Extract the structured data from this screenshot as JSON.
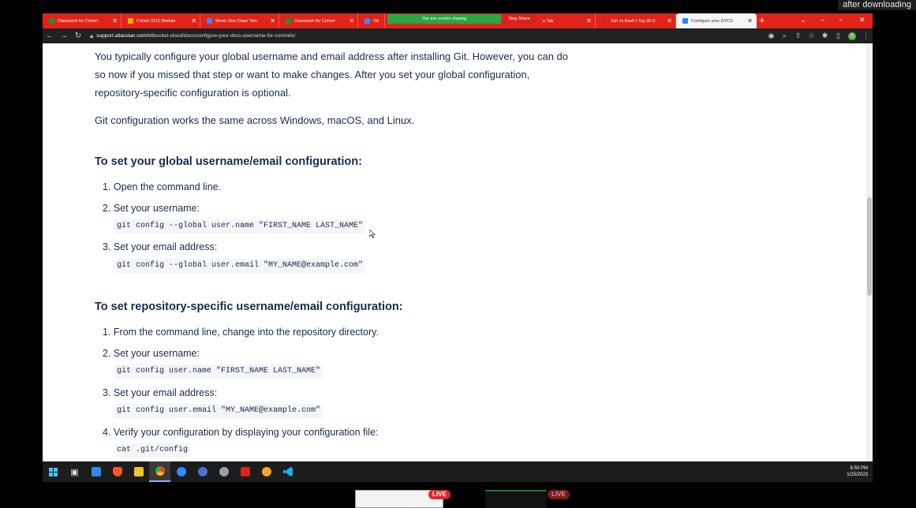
{
  "caption": "after downloading",
  "browser": {
    "tabs": [
      {
        "label": "Classwork for Cohort",
        "color": "#1e8e3e"
      },
      {
        "label": "Cohort 2211 Module",
        "color": "#f9ab00"
      },
      {
        "label": "Week One Class Two",
        "color": "#4285f4"
      },
      {
        "label": "Classwork for Cohort",
        "color": "#1e8e3e"
      },
      {
        "label": "Git",
        "color": "#4285f4"
      },
      {
        "label": "e Tab",
        "color": "#d9231a"
      },
      {
        "label": "Zsh vs Bash | Top 36 D",
        "color": "#d9231a"
      },
      {
        "label": "Configure your DVCS",
        "color": "#2684ff"
      }
    ],
    "share_banner": "You are screen sharing",
    "stop_share": "Stop Share",
    "new_tab_icon": "+",
    "url_host": "support.atlassian.com",
    "url_path": "/bitbucket-cloud/docs/configure-your-dvcs-username-for-commits/",
    "profile_initial": "S"
  },
  "article": {
    "intro": "You typically configure your global username and email address after installing Git. However, you can do so now if you missed that step or want to make changes. After you set your global configuration, repository-specific configuration is optional.",
    "platforms": "Git configuration works the same across Windows, macOS, and Linux.",
    "global": {
      "heading": "To set your global username/email configuration:",
      "step1": "1. Open the command line.",
      "step2": "2. Set your username:",
      "code2": "git config --global user.name \"FIRST_NAME LAST_NAME\"",
      "step3": "3. Set your email address:",
      "code3": "git config --global user.email \"MY_NAME@example.com\""
    },
    "repo": {
      "heading": "To set repository-specific username/email configuration:",
      "step1": "1. From the command line, change into the repository directory.",
      "step2": "2. Set your username:",
      "code2": "git config user.name \"FIRST_NAME LAST_NAME\"",
      "step3": "3. Set your email address:",
      "code3": "git config user.email \"MY_NAME@example.com\"",
      "step4": "4. Verify your configuration by displaying your configuration file:",
      "code4": "cat .git/config"
    }
  },
  "taskbar": {
    "time": "6:50 PM",
    "date": "1/25/2023"
  },
  "live_label": "LIVE"
}
